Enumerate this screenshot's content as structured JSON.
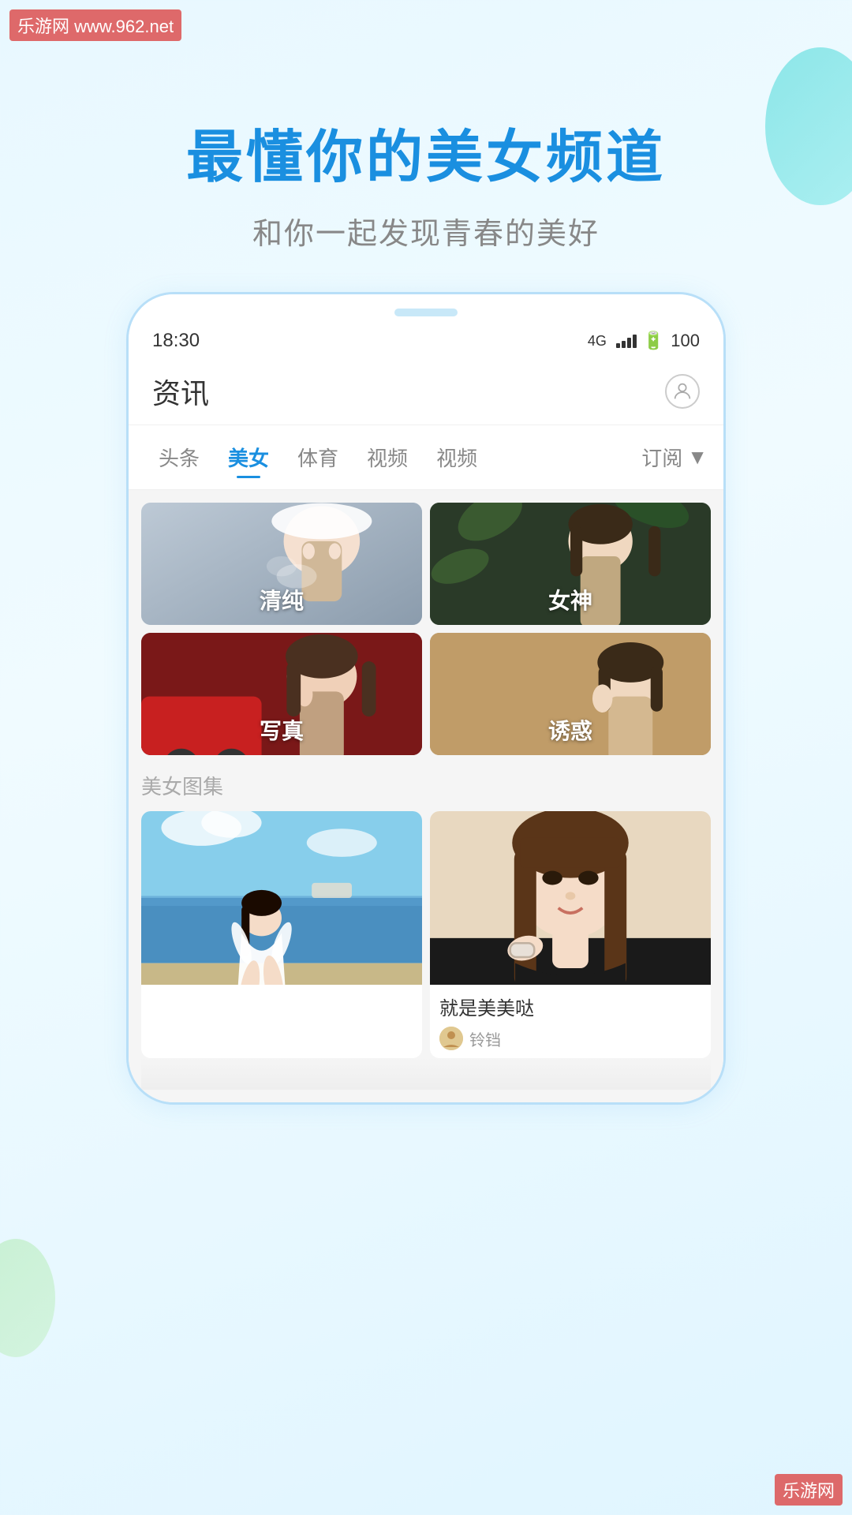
{
  "watermark": {
    "top": "乐游网 www.962.net",
    "bottom": "乐游网"
  },
  "hero": {
    "title": "最懂你的美女频道",
    "subtitle": "和你一起发现青春的美好"
  },
  "phone": {
    "status_bar": {
      "time": "18:30",
      "network": "4G",
      "battery": "100"
    },
    "header": {
      "title": "资讯",
      "user_icon": "👤"
    },
    "tabs": [
      {
        "label": "头条",
        "active": false
      },
      {
        "label": "美女",
        "active": true
      },
      {
        "label": "体育",
        "active": false
      },
      {
        "label": "视频",
        "active": false
      },
      {
        "label": "视频",
        "active": false
      },
      {
        "label": "订阅",
        "active": false
      }
    ],
    "categories": [
      {
        "label": "清纯",
        "color_class": "cat-bg-1"
      },
      {
        "label": "女神",
        "color_class": "cat-bg-2"
      },
      {
        "label": "写真",
        "color_class": "cat-bg-3"
      },
      {
        "label": "诱惑",
        "color_class": "cat-bg-4"
      }
    ],
    "section_title": "美女图集",
    "albums": [
      {
        "desc": "",
        "author_name": ""
      },
      {
        "desc": "就是美美哒",
        "author_name": "铃铛"
      }
    ]
  }
}
